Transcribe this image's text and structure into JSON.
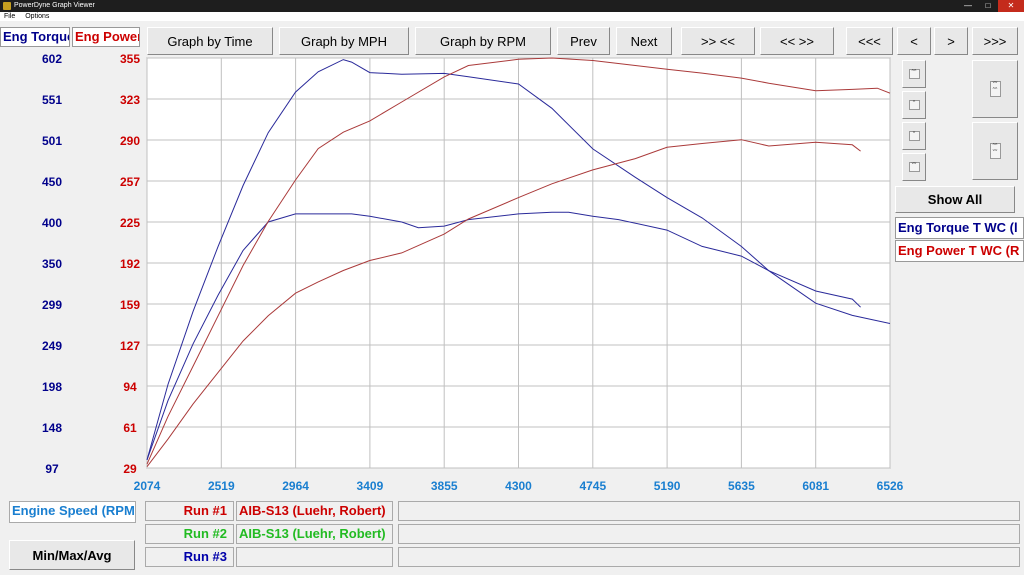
{
  "window": {
    "title": "PowerDyne Graph Viewer"
  },
  "menu": [
    "File",
    "Options"
  ],
  "toolbar": {
    "graph_time": "Graph by Time",
    "graph_mph": "Graph by MPH",
    "graph_rpm": "Graph by RPM",
    "prev": "Prev",
    "next": "Next",
    "zoom_in": ">> <<",
    "zoom_out": "<< >>",
    "first": "<<<",
    "back": "<",
    "forward": ">",
    "last": ">>>"
  },
  "axis_headers": {
    "torque": "Eng Torque",
    "power": "Eng Power"
  },
  "side": {
    "show_all": "Show All",
    "legend_torque": "Eng Torque T WC (l",
    "legend_power": "Eng Power T WC (R"
  },
  "bottom": {
    "xaxis_label": "Engine Speed (RPM",
    "minmax": "Min/Max/Avg",
    "runs": [
      {
        "label": "Run #1",
        "name": "AIB-S13 (Luehr, Robert)",
        "color": "#cc0000"
      },
      {
        "label": "Run #2",
        "name": "AIB-S13 (Luehr, Robert)",
        "color": "#22bb22"
      },
      {
        "label": "Run #3",
        "name": "",
        "color": "#0000aa"
      }
    ]
  },
  "colors": {
    "torque": "#00008b",
    "power": "#cc0000",
    "xaxis": "#1a7fd0",
    "torque_line": "#2a2a9a",
    "power_line": "#aa3a3a"
  },
  "chart_data": {
    "type": "line",
    "x_ticks": [
      "2074",
      "2519",
      "2964",
      "3409",
      "3855",
      "4300",
      "4745",
      "5190",
      "5635",
      "6081",
      "6526"
    ],
    "y_left_ticks": [
      "602",
      "551",
      "501",
      "450",
      "400",
      "350",
      "299",
      "249",
      "198",
      "148",
      "97"
    ],
    "y_right_ticks": [
      "355",
      "323",
      "290",
      "257",
      "225",
      "192",
      "159",
      "127",
      "94",
      "61",
      "29"
    ],
    "xlim": [
      2074,
      6526
    ],
    "ylim_left": [
      97,
      602
    ],
    "ylim_right": [
      29,
      355
    ],
    "grid": true,
    "series": [
      {
        "axis": "left",
        "x": [
          2074,
          2200,
          2350,
          2500,
          2650,
          2800,
          2964,
          3100,
          3250,
          3300,
          3409,
          3600,
          3855,
          4000,
          4300,
          4500,
          4745,
          5000,
          5190,
          5400,
          5635,
          5800,
          6081,
          6300,
          6526
        ],
        "y": [
          107,
          200,
          290,
          370,
          445,
          510,
          560,
          585,
          600,
          597,
          584,
          582,
          583,
          579,
          570,
          540,
          490,
          455,
          430,
          405,
          370,
          340,
          300,
          285,
          275
        ]
      },
      {
        "axis": "left",
        "x": [
          2074,
          2200,
          2350,
          2500,
          2650,
          2800,
          2964,
          3100,
          3300,
          3409,
          3600,
          3700,
          3855,
          4000,
          4300,
          4500,
          4600,
          4745,
          4900,
          5190,
          5400,
          5635,
          5800,
          6081,
          6300,
          6350
        ],
        "y": [
          107,
          180,
          250,
          310,
          365,
          400,
          410,
          410,
          410,
          407,
          400,
          393,
          395,
          403,
          410,
          412,
          412,
          407,
          403,
          390,
          370,
          358,
          340,
          315,
          305,
          295
        ]
      },
      {
        "axis": "right",
        "x": [
          2074,
          2200,
          2350,
          2500,
          2650,
          2800,
          2964,
          3100,
          3250,
          3409,
          3600,
          3855,
          4000,
          4300,
          4500,
          4745,
          5000,
          5190,
          5400,
          5635,
          5800,
          6081,
          6300,
          6450,
          6526
        ],
        "y": [
          32,
          70,
          110,
          150,
          190,
          225,
          258,
          283,
          296,
          305,
          320,
          340,
          349,
          354,
          355,
          353,
          349,
          346,
          343,
          339,
          335,
          329,
          330,
          331,
          327
        ]
      },
      {
        "axis": "right",
        "x": [
          2074,
          2200,
          2350,
          2500,
          2650,
          2800,
          2964,
          3100,
          3250,
          3409,
          3600,
          3855,
          4000,
          4300,
          4500,
          4745,
          5000,
          5190,
          5400,
          5635,
          5800,
          6081,
          6300,
          6350
        ],
        "y": [
          30,
          52,
          80,
          105,
          130,
          150,
          168,
          177,
          186,
          194,
          200,
          215,
          227,
          244,
          255,
          266,
          275,
          284,
          287,
          290,
          285,
          288,
          286,
          281
        ]
      }
    ]
  }
}
